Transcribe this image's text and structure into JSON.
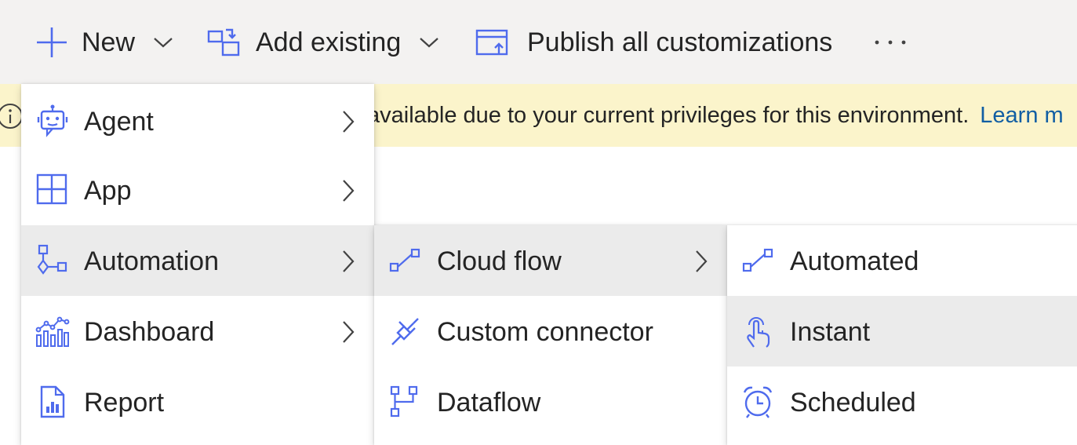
{
  "toolbar": {
    "new_label": "New",
    "add_existing_label": "Add existing",
    "publish_label": "Publish all customizations",
    "more_label": "···"
  },
  "banner": {
    "message": "available due to your current privileges for this environment.",
    "link_label": "Learn m"
  },
  "new_menu": {
    "items": [
      {
        "label": "Agent",
        "icon": "bot-icon",
        "has_submenu": true
      },
      {
        "label": "App",
        "icon": "app-grid-icon",
        "has_submenu": true
      },
      {
        "label": "Automation",
        "icon": "automation-icon",
        "has_submenu": true,
        "highlighted": true
      },
      {
        "label": "Dashboard",
        "icon": "dashboard-icon",
        "has_submenu": true
      },
      {
        "label": "Report",
        "icon": "report-icon",
        "has_submenu": false
      }
    ]
  },
  "automation_menu": {
    "items": [
      {
        "label": "Cloud flow",
        "icon": "cloud-flow-icon",
        "has_submenu": true,
        "highlighted": true
      },
      {
        "label": "Custom connector",
        "icon": "plug-icon",
        "has_submenu": false
      },
      {
        "label": "Dataflow",
        "icon": "dataflow-icon",
        "has_submenu": false
      }
    ]
  },
  "cloud_flow_menu": {
    "items": [
      {
        "label": "Automated",
        "icon": "cloud-flow-icon"
      },
      {
        "label": "Instant",
        "icon": "touch-icon",
        "highlighted": true
      },
      {
        "label": "Scheduled",
        "icon": "alarm-icon"
      }
    ]
  },
  "colors": {
    "icon_accent": "#4f6bed",
    "toolbar_bg": "#f3f2f1",
    "banner_bg": "#fbf4cb",
    "hover_bg": "#ebebeb",
    "link": "#115ea3"
  }
}
